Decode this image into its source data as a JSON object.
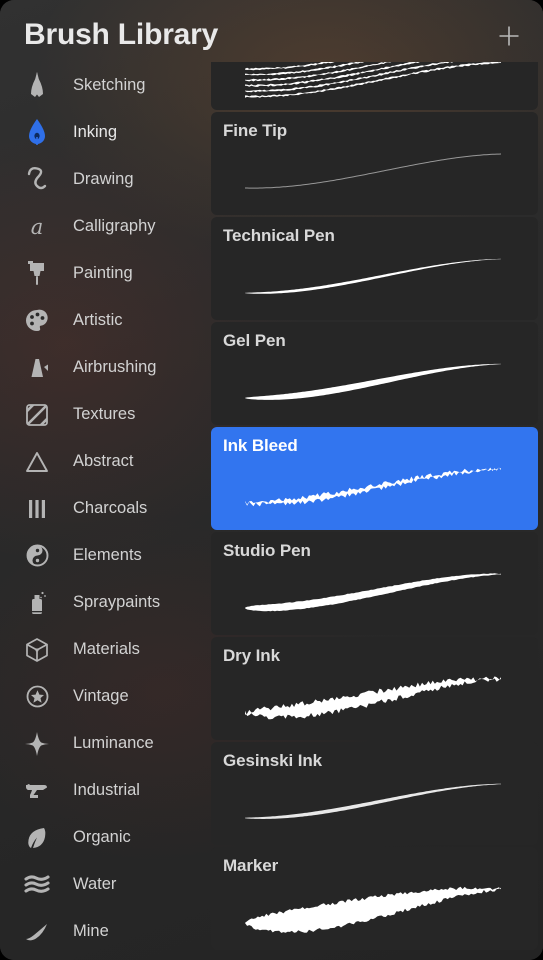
{
  "header": {
    "title": "Brush Library",
    "add_label": "+",
    "add_icon": "plus-icon"
  },
  "colors": {
    "accent_selected": "#3275ef",
    "panel_bg": "#2b2b2b",
    "card_bg": "#262626",
    "text_primary": "#e9e9e9",
    "text_secondary": "#d2d2d2",
    "inking_icon": "#2f6fe8"
  },
  "sidebar": {
    "selected": "Inking",
    "items": [
      {
        "label": "Sketching",
        "icon": "pencil-tip-icon"
      },
      {
        "label": "Inking",
        "icon": "pen-nib-icon"
      },
      {
        "label": "Drawing",
        "icon": "squiggle-icon"
      },
      {
        "label": "Calligraphy",
        "icon": "script-a-icon"
      },
      {
        "label": "Painting",
        "icon": "paint-brush-icon"
      },
      {
        "label": "Artistic",
        "icon": "palette-icon"
      },
      {
        "label": "Airbrushing",
        "icon": "airbrush-icon"
      },
      {
        "label": "Textures",
        "icon": "hatched-square-icon"
      },
      {
        "label": "Abstract",
        "icon": "triangle-icon"
      },
      {
        "label": "Charcoals",
        "icon": "three-bars-icon"
      },
      {
        "label": "Elements",
        "icon": "yin-yang-icon"
      },
      {
        "label": "Spraypaints",
        "icon": "spray-can-icon"
      },
      {
        "label": "Materials",
        "icon": "cube-icon"
      },
      {
        "label": "Vintage",
        "icon": "star-circle-icon"
      },
      {
        "label": "Luminance",
        "icon": "sparkle-icon"
      },
      {
        "label": "Industrial",
        "icon": "anvil-icon"
      },
      {
        "label": "Organic",
        "icon": "leaf-icon"
      },
      {
        "label": "Water",
        "icon": "waves-icon"
      },
      {
        "label": "Mine",
        "icon": "swoosh-icon"
      }
    ]
  },
  "brush_list": {
    "selected": "Ink Bleed",
    "brushes": [
      {
        "name": "",
        "stroke": "rake",
        "partial": true
      },
      {
        "name": "Fine Tip",
        "stroke": "hairline",
        "partial": false
      },
      {
        "name": "Technical Pen",
        "stroke": "thin-tapered",
        "partial": false
      },
      {
        "name": "Gel Pen",
        "stroke": "smooth-round",
        "partial": false
      },
      {
        "name": "Ink Bleed",
        "stroke": "rough-tapered",
        "partial": false
      },
      {
        "name": "Studio Pen",
        "stroke": "calligraphic",
        "partial": false
      },
      {
        "name": "Dry Ink",
        "stroke": "grainy-broad",
        "partial": false
      },
      {
        "name": "Gesinski Ink",
        "stroke": "fine-swell",
        "partial": false
      },
      {
        "name": "Marker",
        "stroke": "thick-chisel",
        "partial": false
      }
    ]
  }
}
